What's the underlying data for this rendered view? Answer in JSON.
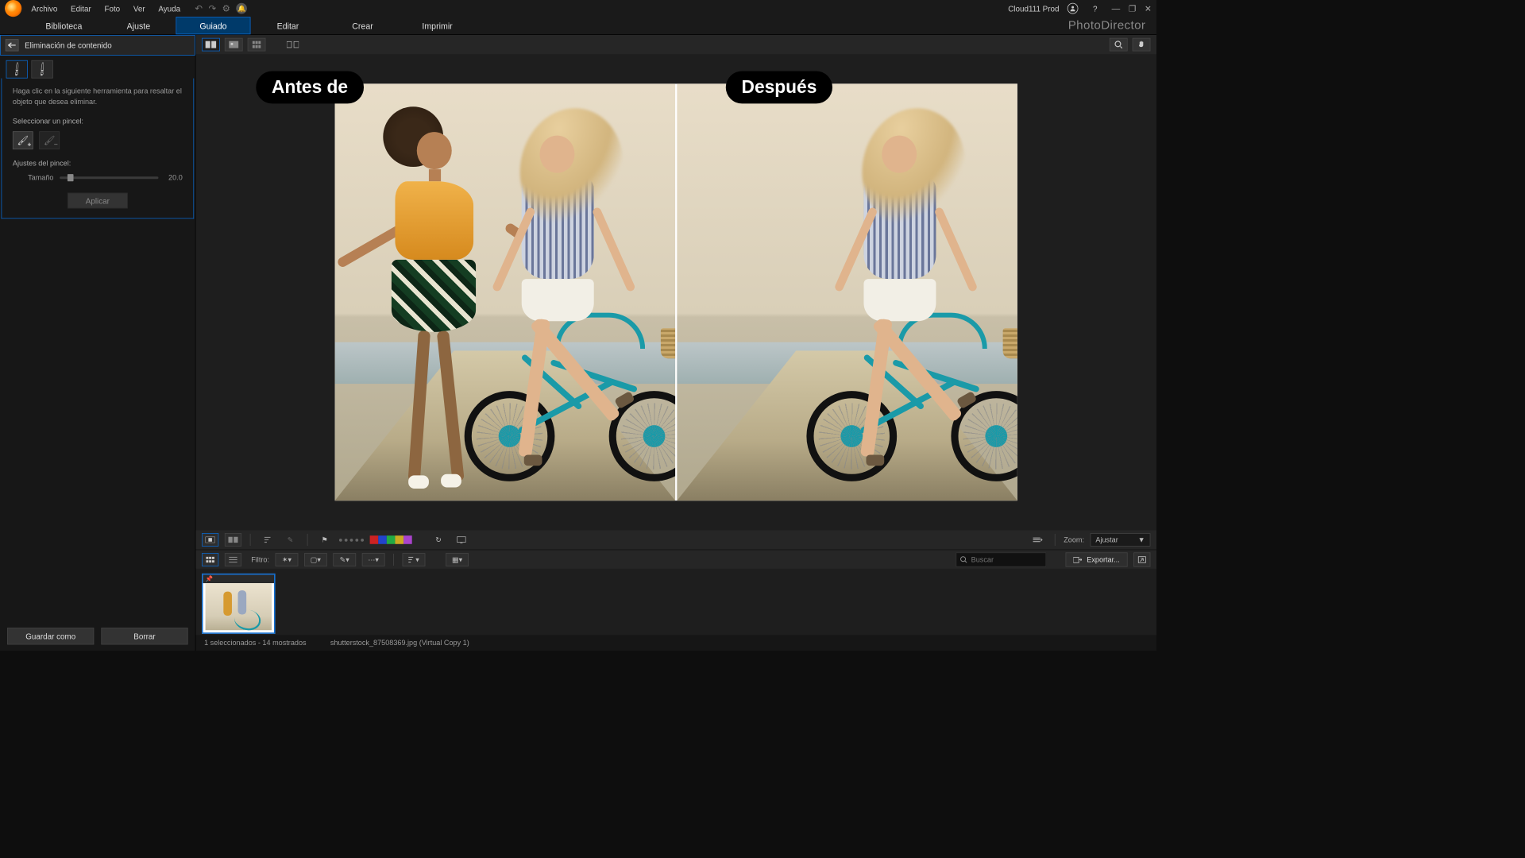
{
  "menu": {
    "file": "Archivo",
    "edit": "Editar",
    "photo": "Foto",
    "view": "Ver",
    "help": "Ayuda"
  },
  "user": {
    "name": "Cloud111 Prod"
  },
  "brand": "PhotoDirector",
  "modules": {
    "library": "Biblioteca",
    "adjust": "Ajuste",
    "guided": "Guiado",
    "edit": "Editar",
    "create": "Crear",
    "print": "Imprimir"
  },
  "panel": {
    "title": "Eliminación de contenido",
    "instruction": "Haga clic en la siguiente herramienta para resaltar el objeto que desea eliminar.",
    "select_brush": "Seleccionar un pincel:",
    "brush_settings": "Ajustes del pincel:",
    "size_label": "Tamaño",
    "size_value": "20.0",
    "apply": "Aplicar",
    "save_as": "Guardar como",
    "clear": "Borrar"
  },
  "viewer": {
    "before": "Antes de",
    "after": "Después"
  },
  "zoom": {
    "label": "Zoom:",
    "value": "Ajustar"
  },
  "filter": {
    "label": "Filtro:"
  },
  "search": {
    "placeholder": "Buscar"
  },
  "export": {
    "label": "Exportar..."
  },
  "colors": [
    "#cc2222",
    "#2244cc",
    "#22aa44",
    "#ccaa22",
    "#aa44cc"
  ],
  "status": {
    "selection": "1 seleccionados - 14 mostrados",
    "filename": "shutterstock_87508369.jpg (Virtual Copy 1)"
  }
}
